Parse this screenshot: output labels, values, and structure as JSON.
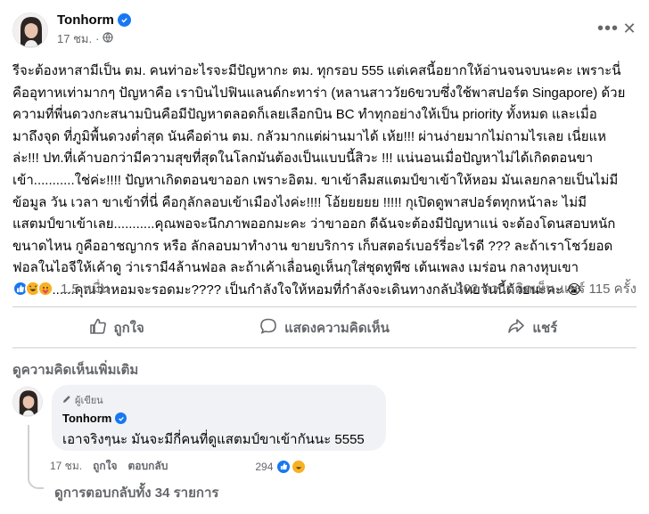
{
  "post": {
    "author": "Tonhorm",
    "time": "17 ชม.",
    "body": "รีจะต้องหาสามีเป็น ตม. คนท่าอะไรจะมีปัญหากะ ตม. ทุกรอบ 555 แต่เคสนี้อยากให้อ่านจนจบนะคะ เพราะนี่\nคืออุทาหเท่ามากๆ  ปัญหาคือ เราบินไปฟินแลนด์กะทาร่า (หลานสาววัย6ขวบซึ่งใช้พาสปอร์ต Singapore) ด้วย\nความที่พี่นดวงกะสนามบินคือมีปัญหาตลอดก็เลยเลือกบิน BC ทำทุกอย่างให้เป็น priority ทั้งหมด และเมื่อ\nมาถึงจุด ที่ภูมิพื้นดวงต่ำสุด นันคือด่าน ตม. กลัวมากแต่ผ่านมาได้ เห้ย!!! ผ่านง่ายมากไม่ถามไรเลย เนี่ยแห\nล่ะ!!! ปท.ที่เค้าบอกว่ามีความสุขที่สุดในโลกมันต้องเป็นแบบนี้สิวะ !!!  แน่นอนเมื่อปัญหาไม่ได้เกิดตอนขา\nเข้า...........ใช่ค่ะ!!!! ปัญหาเกิดตอนขาออก เพราะอิตม. ขาเข้าลืมสแตมป์ขาเข้าให้หอม มันเลยกลายเป็นไม่มี\nข้อมูล วัน เวลา ขาเข้าที่นี่ คือกุลักลอบเข้าเมืองไงค่ะ!!!! โอ้ยยยยย !!!!! กุเปิดดูพาสปอร์ตทุกหน้าละ ไม่มี\nแสตมป์ขาเข้าเลย...........คุณพอจะนึกภาพออกมะคะ ว่าขาออก ดีฉันจะต้องมีปัญหาแน่ จะต้องโดนสอบหนัก\nขนาดไหน กูคืออาชญากร หรือ ลักลอบมาทำงาน ขายบริการ เก็บสตอร์เบอร์รี่อะไรดี ??? ละถ้าเราโชว์ยอด\nฟอลในไอจีให้เค้าดู ว่าเรามี4ล้านฟอล ละถ้าเค้าเลื่อนดูเห็นกุใส่ชุดทูพีซ เต้นเพลง เมร่อน กลางหุบเขา\nหิมะ..........คุณว่าหอมจะรอดมะ???? เป็นกำลังใจให้หอมที่กำลังจะเดินทางกลับไทยวันนี้ด้วยนะคะ 😭",
    "reaction_count": "1.5 หมื่น",
    "comment_count": "302 ความคิดเห็น",
    "share_count": "แชร์ 115 ครั้ง"
  },
  "actions": {
    "like": "ถูกใจ",
    "comment": "แสดงความคิดเห็น",
    "share": "แชร์"
  },
  "comments_section": {
    "more_label": "ดูความคิดเห็นเพิ่มเติม",
    "comment": {
      "badge": "ผู้เขียน",
      "author": "Tonhorm",
      "text": "เอาจริงๆนะ มันจะมีกี่คนที่ดูแสตมป์ขาเข้ากันนะ 5555",
      "time": "17 ชม.",
      "like_label": "ถูกใจ",
      "reply_label": "ตอบกลับ",
      "reaction_count": "294"
    },
    "view_replies": "ดูการตอบกลับทั้ง 34 รายการ"
  },
  "colors": {
    "accent": "#1877f2",
    "muted_text": "#65676b",
    "bubble": "#f0f2f5"
  },
  "icons": [
    "verified-icon",
    "globe-icon",
    "more-icon",
    "close-icon",
    "like-icon",
    "comment-icon",
    "share-icon",
    "pencil-icon"
  ]
}
